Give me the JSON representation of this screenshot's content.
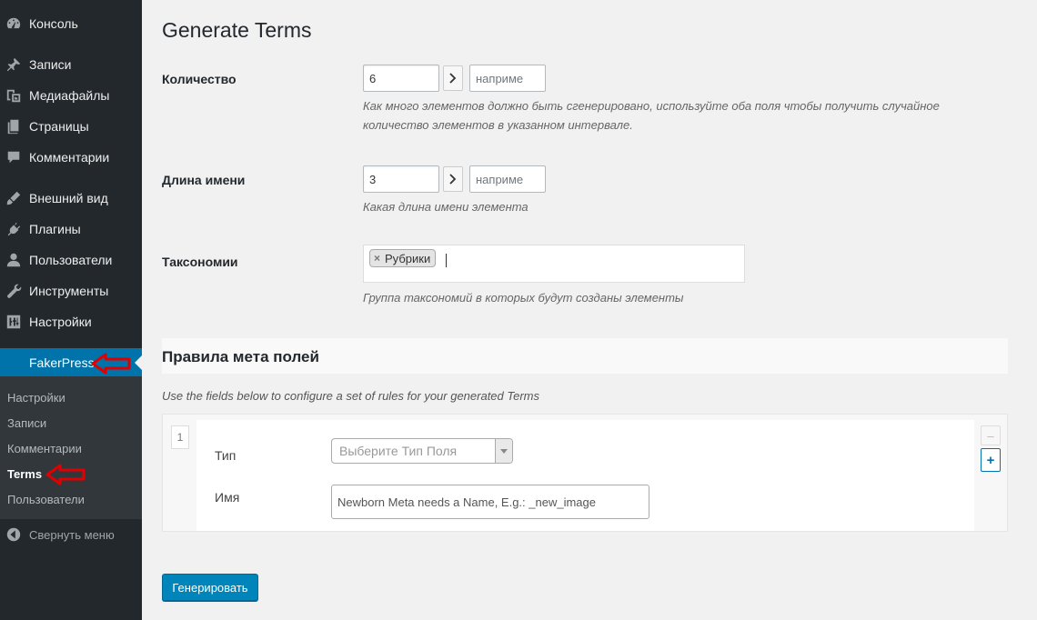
{
  "sidebar": {
    "items": [
      {
        "label": "Консоль",
        "icon": "dashboard-icon"
      },
      {
        "label": "Записи",
        "icon": "pin-icon"
      },
      {
        "label": "Медиафайлы",
        "icon": "media-icon"
      },
      {
        "label": "Страницы",
        "icon": "pages-icon"
      },
      {
        "label": "Комментарии",
        "icon": "comments-icon"
      },
      {
        "label": "Внешний вид",
        "icon": "appearance-icon"
      },
      {
        "label": "Плагины",
        "icon": "plugins-icon"
      },
      {
        "label": "Пользователи",
        "icon": "users-icon"
      },
      {
        "label": "Инструменты",
        "icon": "tools-icon"
      },
      {
        "label": "Настройки",
        "icon": "settings-icon"
      }
    ],
    "active_item": "FakerPress",
    "submenu": [
      "Настройки",
      "Записи",
      "Комментарии",
      "Terms",
      "Пользователи"
    ],
    "current_submenu": "Terms",
    "collapse_label": "Свернуть меню"
  },
  "page": {
    "title": "Generate Terms",
    "quantity": {
      "label": "Количество",
      "min_value": "6",
      "max_placeholder": "наприме",
      "description": "Как много элементов должно быть сгенерировано, используйте оба поля чтобы получить случайное количество элементов в указанном интервале."
    },
    "name_length": {
      "label": "Длина имени",
      "min_value": "3",
      "max_placeholder": "наприме",
      "description": "Какая длина имени элемента"
    },
    "taxonomies": {
      "label": "Таксономии",
      "selected": "Рубрики",
      "remove_symbol": "×",
      "description": "Группа таксономий в которых будут созданы элементы"
    },
    "meta": {
      "heading": "Правила мета полей",
      "note": "Use the fields below to configure a set of rules for your generated Terms",
      "index": "1",
      "type_label": "Тип",
      "type_placeholder": "Выберите Тип Поля",
      "name_label": "Имя",
      "name_placeholder": "Newborn Meta needs a Name, E.g.: _new_image",
      "remove_symbol": "–",
      "add_symbol": "+"
    },
    "submit_label": "Генерировать"
  },
  "colors": {
    "sidebar_bg": "#23282d",
    "submenu_bg": "#32373c",
    "accent": "#0073aa",
    "annotation_arrow": "#e00000"
  }
}
